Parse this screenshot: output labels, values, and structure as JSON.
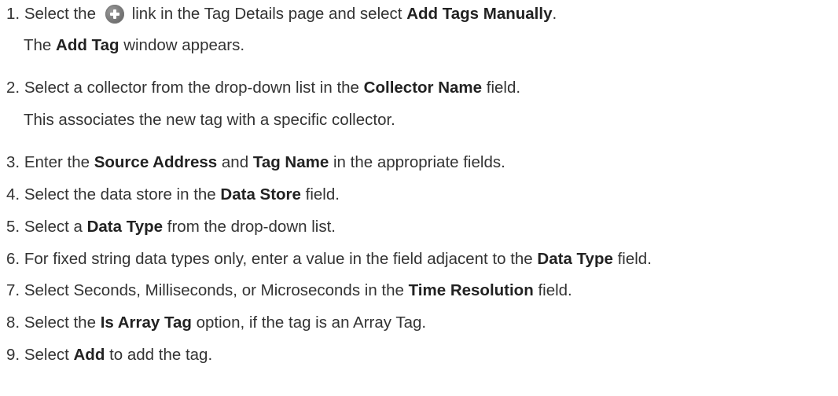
{
  "steps": [
    {
      "number": "1.",
      "parts": [
        "Select the",
        "link in the Tag Details page and select",
        "Add Tags Manually",
        "."
      ],
      "note": [
        "The",
        "Add Tag",
        "window appears."
      ]
    },
    {
      "number": "2.",
      "parts": [
        "Select a collector from the drop-down list in the",
        "Collector Name",
        "field."
      ],
      "note": [
        "This associates the new tag with a specific collector."
      ]
    },
    {
      "number": "3.",
      "parts": [
        "Enter the",
        "Source Address",
        "and",
        "Tag Name",
        "in the appropriate fields."
      ]
    },
    {
      "number": "4.",
      "parts": [
        "Select the data store in the",
        "Data Store",
        "field."
      ]
    },
    {
      "number": "5.",
      "parts": [
        "Select a",
        "Data Type",
        "from the drop-down list."
      ]
    },
    {
      "number": "6.",
      "parts": [
        "For fixed string data types only, enter a value in the field adjacent to the",
        "Data Type",
        "field."
      ]
    },
    {
      "number": "7.",
      "parts": [
        "Select Seconds, Milliseconds, or Microseconds in the",
        "Time Resolution",
        "field."
      ]
    },
    {
      "number": "8.",
      "parts": [
        "Select the",
        "Is Array Tag",
        "option, if the tag is an Array Tag."
      ]
    },
    {
      "number": "9.",
      "parts": [
        "Select",
        "Add",
        "to add the tag."
      ]
    }
  ],
  "icons": {
    "add": "plus-circle-icon"
  }
}
